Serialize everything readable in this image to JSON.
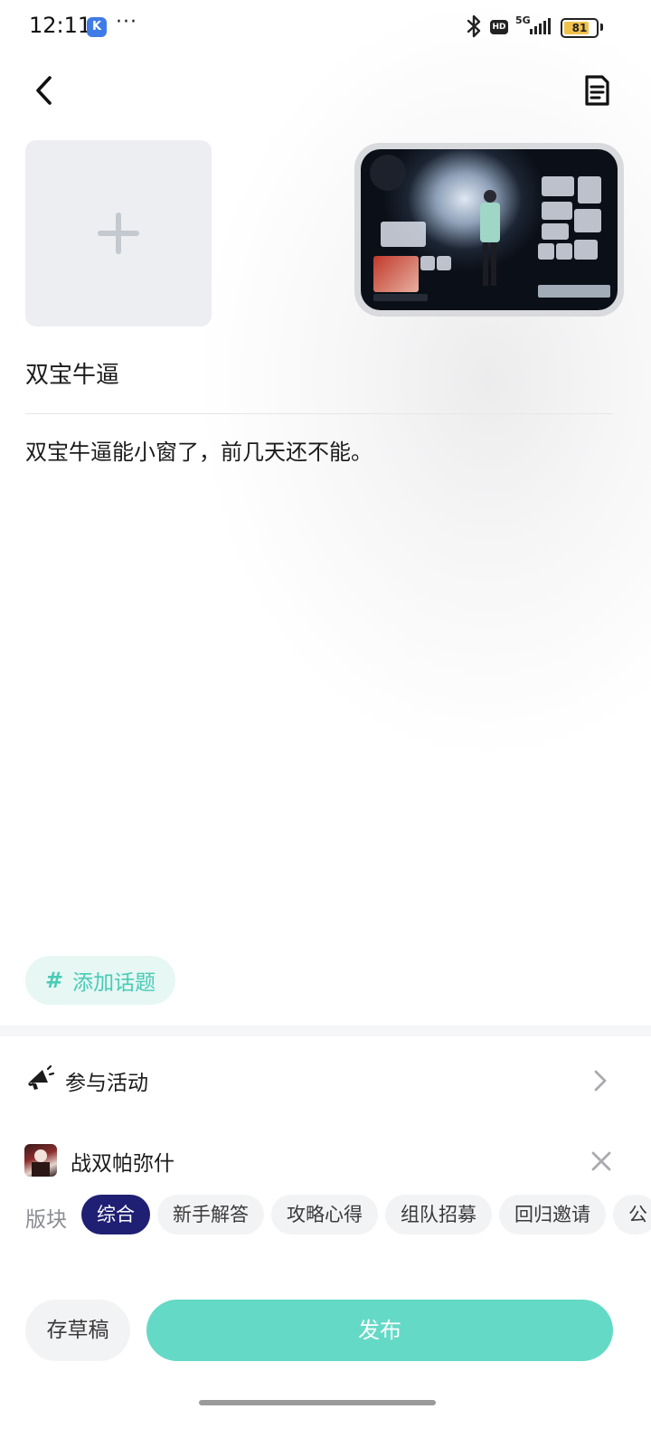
{
  "status_bar": {
    "time": "12:11",
    "app_icon_letter": "K",
    "more": "···",
    "hd": "HD",
    "network": "5G",
    "battery": "81",
    "battery_level": 0.81
  },
  "header": {
    "back_icon": "chevron-left-icon",
    "draft_icon": "document-list-icon"
  },
  "media": {
    "add_icon": "plus-icon",
    "attached_screenshot": "game-screenshot-thumbnail"
  },
  "post": {
    "title": "双宝牛逼",
    "body": "双宝牛逼能小窗了，前几天还不能。"
  },
  "topic": {
    "hash": "#",
    "label": "添加话题",
    "color": "#49cbb5"
  },
  "activity": {
    "label": "参与活动",
    "icon": "megaphone-icon"
  },
  "game": {
    "name": "战双帕弥什",
    "icon": "game-avatar-icon"
  },
  "sections": {
    "label": "版块",
    "items": [
      "综合",
      "新手解答",
      "攻略心得",
      "组队招募",
      "回归邀请",
      "公"
    ],
    "selected": "综合",
    "active_color": "#1f1f74"
  },
  "actions": {
    "save_draft": "存草稿",
    "publish": "发布",
    "publish_color": "#64d9c6"
  }
}
